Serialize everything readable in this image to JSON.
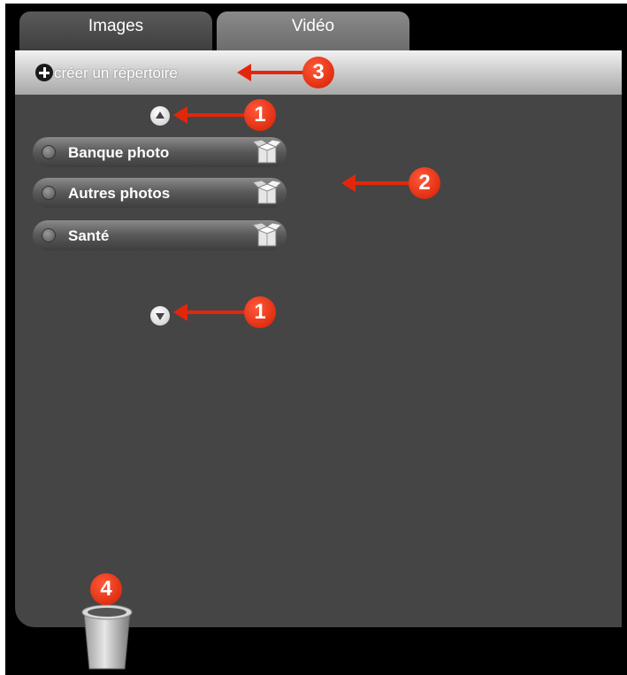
{
  "tabs": [
    {
      "label": "Images"
    },
    {
      "label": "Vidéo"
    }
  ],
  "toolbar": {
    "create_folder_label": "créer un répertoire",
    "create_folder_icon": "plus-circle-icon"
  },
  "folders": [
    {
      "label": "Banque photo",
      "icon": "box-icon"
    },
    {
      "label": "Autres photos",
      "icon": "box-icon"
    },
    {
      "label": "Santé",
      "icon": "box-icon"
    }
  ],
  "scroll": {
    "up_icon": "arrow-up-icon",
    "down_icon": "arrow-down-icon"
  },
  "trash": {
    "icon": "trash-icon"
  },
  "annotations": [
    {
      "number": "1"
    },
    {
      "number": "1"
    },
    {
      "number": "2"
    },
    {
      "number": "3"
    },
    {
      "number": "4"
    }
  ],
  "colors": {
    "panel": "#454545",
    "marker": "#e3260b",
    "background": "#000000"
  }
}
